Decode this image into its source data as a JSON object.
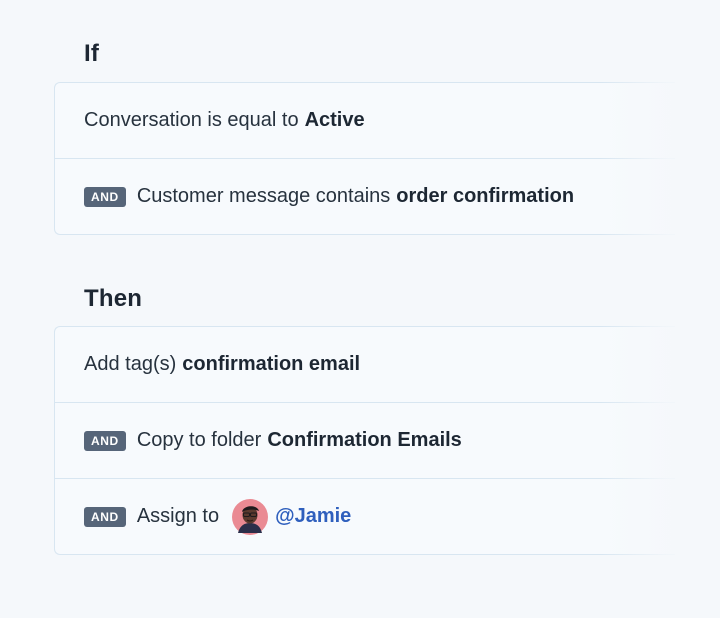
{
  "if_section": {
    "heading": "If",
    "conditions": [
      {
        "text": "Conversation is equal to",
        "value": "Active"
      },
      {
        "badge": "AND",
        "text": "Customer message contains",
        "value": "order confirmation"
      }
    ]
  },
  "then_section": {
    "heading": "Then",
    "actions": [
      {
        "text": "Add tag(s)",
        "value": "confirmation email"
      },
      {
        "badge": "AND",
        "text": "Copy to folder",
        "value": "Confirmation Emails"
      },
      {
        "badge": "AND",
        "text": "Assign to",
        "mention": "@Jamie",
        "avatar_icon": "user-avatar"
      }
    ]
  },
  "colors": {
    "background": "#f5f8fb",
    "badge": "#566579",
    "mention": "#2f5fbd",
    "border": "#d8e6f1"
  }
}
